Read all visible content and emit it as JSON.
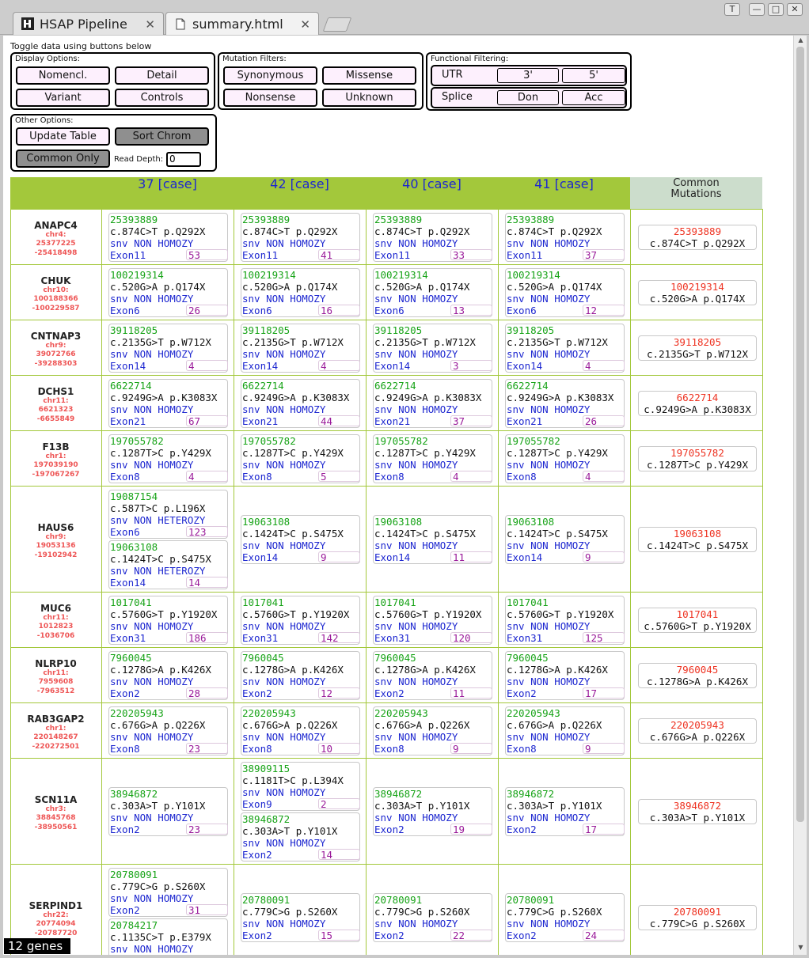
{
  "browser": {
    "tabs": [
      {
        "label": "HSAP Pipeline",
        "icon": "pipeline-app-icon"
      },
      {
        "label": "summary.html",
        "icon": "document-icon"
      }
    ],
    "window_buttons": [
      "T",
      "—",
      "□",
      "✕"
    ]
  },
  "toolbar": {
    "note": "Toggle data using buttons below",
    "display": {
      "title": "Display Options:",
      "buttons": [
        "Nomencl.",
        "Detail",
        "Variant",
        "Controls"
      ]
    },
    "mutation": {
      "title": "Mutation Filters:",
      "buttons": [
        "Synonymous",
        "Missense",
        "Nonsense",
        "Unknown"
      ]
    },
    "functional": {
      "title": "Functional Filtering:",
      "utr_label": "UTR",
      "utr_buttons": [
        "3'",
        "5'"
      ],
      "splice_label": "Splice",
      "splice_buttons": [
        "Don",
        "Acc"
      ]
    },
    "other": {
      "title": "Other Options:",
      "buttons": [
        "Update Table",
        "Sort Chrom",
        "Common Only"
      ],
      "read_depth_label": "Read Depth:",
      "read_depth_value": "0"
    }
  },
  "table": {
    "samples": [
      "37 [case]",
      "42 [case]",
      "40 [case]",
      "41 [case]"
    ],
    "common_header": "Common\nMutations",
    "rows": [
      {
        "gene": "ANAPC4",
        "chr": "chr4:",
        "start": "25377225",
        "end": "-25418498",
        "samples": [
          [
            {
              "pos": "25393889",
              "cdna": "c.874C>T p.Q292X",
              "type": "snv NON HOMOZY",
              "exon": "Exon11",
              "depth": "53"
            }
          ],
          [
            {
              "pos": "25393889",
              "cdna": "c.874C>T p.Q292X",
              "type": "snv NON HOMOZY",
              "exon": "Exon11",
              "depth": "41"
            }
          ],
          [
            {
              "pos": "25393889",
              "cdna": "c.874C>T p.Q292X",
              "type": "snv NON HOMOZY",
              "exon": "Exon11",
              "depth": "33"
            }
          ],
          [
            {
              "pos": "25393889",
              "cdna": "c.874C>T p.Q292X",
              "type": "snv NON HOMOZY",
              "exon": "Exon11",
              "depth": "37"
            }
          ]
        ],
        "common": {
          "pos": "25393889",
          "cdna": "c.874C>T p.Q292X"
        }
      },
      {
        "gene": "CHUK",
        "chr": "chr10:",
        "start": "100188366",
        "end": "-100229587",
        "samples": [
          [
            {
              "pos": "100219314",
              "cdna": "c.520G>A p.Q174X",
              "type": "snv NON HOMOZY",
              "exon": "Exon6",
              "depth": "26"
            }
          ],
          [
            {
              "pos": "100219314",
              "cdna": "c.520G>A p.Q174X",
              "type": "snv NON HOMOZY",
              "exon": "Exon6",
              "depth": "16"
            }
          ],
          [
            {
              "pos": "100219314",
              "cdna": "c.520G>A p.Q174X",
              "type": "snv NON HOMOZY",
              "exon": "Exon6",
              "depth": "13"
            }
          ],
          [
            {
              "pos": "100219314",
              "cdna": "c.520G>A p.Q174X",
              "type": "snv NON HOMOZY",
              "exon": "Exon6",
              "depth": "12"
            }
          ]
        ],
        "common": {
          "pos": "100219314",
          "cdna": "c.520G>A p.Q174X"
        }
      },
      {
        "gene": "CNTNAP3",
        "chr": "chr9:",
        "start": "39072766",
        "end": "-39288303",
        "samples": [
          [
            {
              "pos": "39118205",
              "cdna": "c.2135G>T p.W712X",
              "type": "snv NON HOMOZY",
              "exon": "Exon14",
              "depth": "4"
            }
          ],
          [
            {
              "pos": "39118205",
              "cdna": "c.2135G>T p.W712X",
              "type": "snv NON HOMOZY",
              "exon": "Exon14",
              "depth": "4"
            }
          ],
          [
            {
              "pos": "39118205",
              "cdna": "c.2135G>T p.W712X",
              "type": "snv NON HOMOZY",
              "exon": "Exon14",
              "depth": "3"
            }
          ],
          [
            {
              "pos": "39118205",
              "cdna": "c.2135G>T p.W712X",
              "type": "snv NON HOMOZY",
              "exon": "Exon14",
              "depth": "4"
            }
          ]
        ],
        "common": {
          "pos": "39118205",
          "cdna": "c.2135G>T p.W712X"
        }
      },
      {
        "gene": "DCHS1",
        "chr": "chr11:",
        "start": "6621323",
        "end": "-6655849",
        "samples": [
          [
            {
              "pos": "6622714",
              "cdna": "c.9249G>A p.K3083X",
              "type": "snv NON HOMOZY",
              "exon": "Exon21",
              "depth": "67"
            }
          ],
          [
            {
              "pos": "6622714",
              "cdna": "c.9249G>A p.K3083X",
              "type": "snv NON HOMOZY",
              "exon": "Exon21",
              "depth": "44"
            }
          ],
          [
            {
              "pos": "6622714",
              "cdna": "c.9249G>A p.K3083X",
              "type": "snv NON HOMOZY",
              "exon": "Exon21",
              "depth": "37"
            }
          ],
          [
            {
              "pos": "6622714",
              "cdna": "c.9249G>A p.K3083X",
              "type": "snv NON HOMOZY",
              "exon": "Exon21",
              "depth": "26"
            }
          ]
        ],
        "common": {
          "pos": "6622714",
          "cdna": "c.9249G>A p.K3083X"
        }
      },
      {
        "gene": "F13B",
        "chr": "chr1:",
        "start": "197039190",
        "end": "-197067267",
        "samples": [
          [
            {
              "pos": "197055782",
              "cdna": "c.1287T>C p.Y429X",
              "type": "snv NON HOMOZY",
              "exon": "Exon8",
              "depth": "4"
            }
          ],
          [
            {
              "pos": "197055782",
              "cdna": "c.1287T>C p.Y429X",
              "type": "snv NON HOMOZY",
              "exon": "Exon8",
              "depth": "5"
            }
          ],
          [
            {
              "pos": "197055782",
              "cdna": "c.1287T>C p.Y429X",
              "type": "snv NON HOMOZY",
              "exon": "Exon8",
              "depth": "4"
            }
          ],
          [
            {
              "pos": "197055782",
              "cdna": "c.1287T>C p.Y429X",
              "type": "snv NON HOMOZY",
              "exon": "Exon8",
              "depth": "4"
            }
          ]
        ],
        "common": {
          "pos": "197055782",
          "cdna": "c.1287T>C p.Y429X"
        }
      },
      {
        "gene": "HAUS6",
        "chr": "chr9:",
        "start": "19053136",
        "end": "-19102942",
        "samples": [
          [
            {
              "pos": "19087154",
              "cdna": "c.587T>C p.L196X",
              "type": "snv NON HETEROZY",
              "exon": "Exon6",
              "depth": "123"
            },
            {
              "pos": "19063108",
              "cdna": "c.1424T>C p.S475X",
              "type": "snv NON HETEROZY",
              "exon": "Exon14",
              "depth": "14"
            }
          ],
          [
            {
              "pos": "19063108",
              "cdna": "c.1424T>C p.S475X",
              "type": "snv NON HOMOZY",
              "exon": "Exon14",
              "depth": "9"
            }
          ],
          [
            {
              "pos": "19063108",
              "cdna": "c.1424T>C p.S475X",
              "type": "snv NON HOMOZY",
              "exon": "Exon14",
              "depth": "11"
            }
          ],
          [
            {
              "pos": "19063108",
              "cdna": "c.1424T>C p.S475X",
              "type": "snv NON HOMOZY",
              "exon": "Exon14",
              "depth": "9"
            }
          ]
        ],
        "common": {
          "pos": "19063108",
          "cdna": "c.1424T>C p.S475X"
        }
      },
      {
        "gene": "MUC6",
        "chr": "chr11:",
        "start": "1012823",
        "end": "-1036706",
        "samples": [
          [
            {
              "pos": "1017041",
              "cdna": "c.5760G>T p.Y1920X",
              "type": "snv NON HOMOZY",
              "exon": "Exon31",
              "depth": "186"
            }
          ],
          [
            {
              "pos": "1017041",
              "cdna": "c.5760G>T p.Y1920X",
              "type": "snv NON HOMOZY",
              "exon": "Exon31",
              "depth": "142"
            }
          ],
          [
            {
              "pos": "1017041",
              "cdna": "c.5760G>T p.Y1920X",
              "type": "snv NON HOMOZY",
              "exon": "Exon31",
              "depth": "120"
            }
          ],
          [
            {
              "pos": "1017041",
              "cdna": "c.5760G>T p.Y1920X",
              "type": "snv NON HOMOZY",
              "exon": "Exon31",
              "depth": "125"
            }
          ]
        ],
        "common": {
          "pos": "1017041",
          "cdna": "c.5760G>T p.Y1920X"
        }
      },
      {
        "gene": "NLRP10",
        "chr": "chr11:",
        "start": "7959608",
        "end": "-7963512",
        "samples": [
          [
            {
              "pos": "7960045",
              "cdna": "c.1278G>A p.K426X",
              "type": "snv NON HOMOZY",
              "exon": "Exon2",
              "depth": "28"
            }
          ],
          [
            {
              "pos": "7960045",
              "cdna": "c.1278G>A p.K426X",
              "type": "snv NON HOMOZY",
              "exon": "Exon2",
              "depth": "12"
            }
          ],
          [
            {
              "pos": "7960045",
              "cdna": "c.1278G>A p.K426X",
              "type": "snv NON HOMOZY",
              "exon": "Exon2",
              "depth": "11"
            }
          ],
          [
            {
              "pos": "7960045",
              "cdna": "c.1278G>A p.K426X",
              "type": "snv NON HOMOZY",
              "exon": "Exon2",
              "depth": "17"
            }
          ]
        ],
        "common": {
          "pos": "7960045",
          "cdna": "c.1278G>A p.K426X"
        }
      },
      {
        "gene": "RAB3GAP2",
        "chr": "chr1:",
        "start": "220148267",
        "end": "-220272501",
        "samples": [
          [
            {
              "pos": "220205943",
              "cdna": "c.676G>A p.Q226X",
              "type": "snv NON HOMOZY",
              "exon": "Exon8",
              "depth": "23"
            }
          ],
          [
            {
              "pos": "220205943",
              "cdna": "c.676G>A p.Q226X",
              "type": "snv NON HOMOZY",
              "exon": "Exon8",
              "depth": "10"
            }
          ],
          [
            {
              "pos": "220205943",
              "cdna": "c.676G>A p.Q226X",
              "type": "snv NON HOMOZY",
              "exon": "Exon8",
              "depth": "9"
            }
          ],
          [
            {
              "pos": "220205943",
              "cdna": "c.676G>A p.Q226X",
              "type": "snv NON HOMOZY",
              "exon": "Exon8",
              "depth": "9"
            }
          ]
        ],
        "common": {
          "pos": "220205943",
          "cdna": "c.676G>A p.Q226X"
        }
      },
      {
        "gene": "SCN11A",
        "chr": "chr3:",
        "start": "38845768",
        "end": "-38950561",
        "samples": [
          [
            {
              "pos": "38946872",
              "cdna": "c.303A>T p.Y101X",
              "type": "snv NON HOMOZY",
              "exon": "Exon2",
              "depth": "23"
            }
          ],
          [
            {
              "pos": "38909115",
              "cdna": "c.1181T>C p.L394X",
              "type": "snv NON HOMOZY",
              "exon": "Exon9",
              "depth": "2"
            },
            {
              "pos": "38946872",
              "cdna": "c.303A>T p.Y101X",
              "type": "snv NON HOMOZY",
              "exon": "Exon2",
              "depth": "14"
            }
          ],
          [
            {
              "pos": "38946872",
              "cdna": "c.303A>T p.Y101X",
              "type": "snv NON HOMOZY",
              "exon": "Exon2",
              "depth": "19"
            }
          ],
          [
            {
              "pos": "38946872",
              "cdna": "c.303A>T p.Y101X",
              "type": "snv NON HOMOZY",
              "exon": "Exon2",
              "depth": "17"
            }
          ]
        ],
        "common": {
          "pos": "38946872",
          "cdna": "c.303A>T p.Y101X"
        }
      },
      {
        "gene": "SERPIND1",
        "chr": "chr22:",
        "start": "20774094",
        "end": "-20787720",
        "samples": [
          [
            {
              "pos": "20780091",
              "cdna": "c.779C>G p.S260X",
              "type": "snv NON HOMOZY",
              "exon": "Exon2",
              "depth": "31"
            },
            {
              "pos": "20784217",
              "cdna": "c.1135C>T p.E379X",
              "type": "snv NON HOMOZY",
              "exon": "",
              "depth": ""
            }
          ],
          [
            {
              "pos": "20780091",
              "cdna": "c.779C>G p.S260X",
              "type": "snv NON HOMOZY",
              "exon": "Exon2",
              "depth": "15"
            }
          ],
          [
            {
              "pos": "20780091",
              "cdna": "c.779C>G p.S260X",
              "type": "snv NON HOMOZY",
              "exon": "Exon2",
              "depth": "22"
            }
          ],
          [
            {
              "pos": "20780091",
              "cdna": "c.779C>G p.S260X",
              "type": "snv NON HOMOZY",
              "exon": "Exon2",
              "depth": "24"
            }
          ]
        ],
        "common": {
          "pos": "20780091",
          "cdna": "c.779C>G p.S260X"
        }
      }
    ]
  },
  "footer": {
    "gene_count": "12 genes"
  },
  "colors": {
    "header_green": "#a3c83b",
    "common_header_bg": "#ccddcc",
    "position_green": "#17a317",
    "type_blue": "#1d27d0",
    "depth_purple": "#9a1a9a",
    "common_red": "#ee3322",
    "gene_red": "#ee5555",
    "button_pink": "#fdf0fd"
  }
}
